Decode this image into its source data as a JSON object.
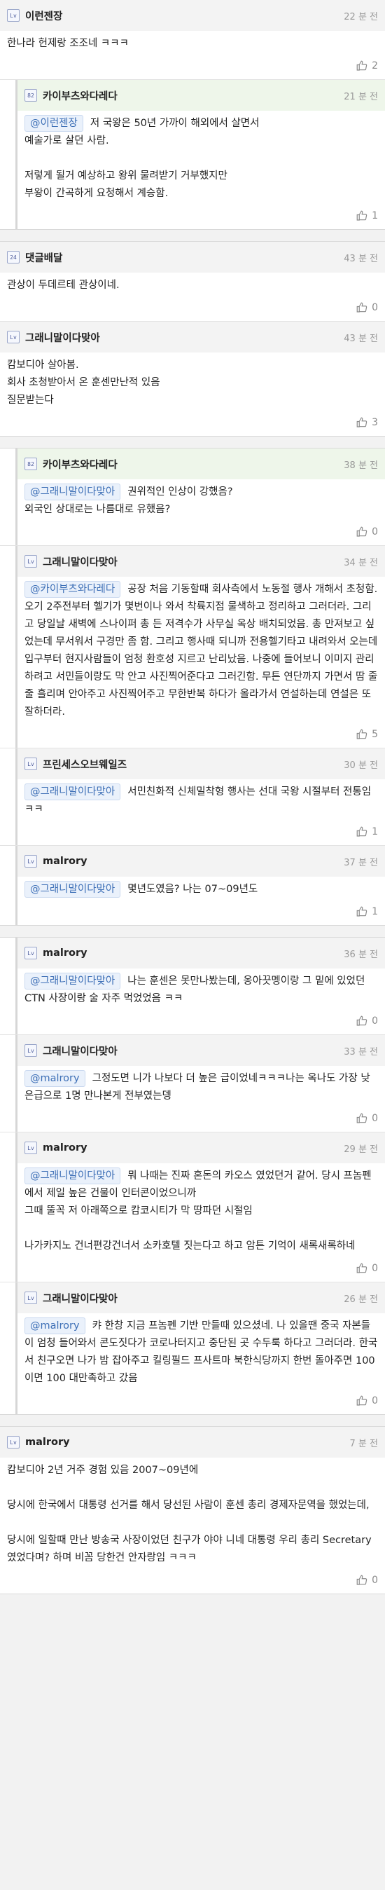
{
  "threads": [
    {
      "comments": [
        {
          "nick": "이런젠장",
          "time": "22 분 전",
          "level": "Lv",
          "header_bg": true,
          "mention": "",
          "text": "한나라 헌제랑 조조네 ㅋㅋㅋ",
          "likes": "2",
          "depth": 0
        },
        {
          "nick": "카이부츠와다레다",
          "time": "21 분 전",
          "level": "82",
          "header_bg": true,
          "hl": true,
          "mention": "@이런젠장",
          "text": "저 국왕은 50년 가까이 해외에서 살면서\n예술가로 살던 사람.\n\n저렇게 될거 예상하고 왕위 물려받기 거부했지만\n부왕이 간곡하게 요청해서 계승함.",
          "likes": "1",
          "depth": 1
        }
      ]
    },
    {
      "comments": [
        {
          "nick": "댓글배달",
          "time": "43 분 전",
          "level": "24",
          "header_bg": true,
          "mention": "",
          "text": "관상이 두데르테 관상이네.",
          "likes": "0",
          "depth": 0
        },
        {
          "nick": "그래니말이다맞아",
          "time": "43 분 전",
          "level": "Lv",
          "header_bg": true,
          "mention": "",
          "text": "캄보디아 살아봄.\n회사 초청받아서 온 훈센만난적 있음\n질문받는다",
          "likes": "3",
          "depth": 0
        }
      ]
    },
    {
      "comments": [
        {
          "nick": "카이부츠와다레다",
          "time": "38 분 전",
          "level": "82",
          "header_bg": true,
          "hl": true,
          "mention": "@그래니말이다맞아",
          "text": "권위적인 인상이 강했음?\n외국인 상대로는 나름대로 유했음?",
          "likes": "0",
          "depth": 1
        },
        {
          "nick": "그래니말이다맞아",
          "time": "34 분 전",
          "level": "Lv",
          "header_bg": true,
          "mention": "@카이부츠와다레다",
          "text": "공장 처음 기동할때 회사측에서 노동절 행사 개해서 초청함. 오기 2주전부터 헬기가 몇번이나 와서 착륙지점 물색하고 정리하고 그러더라. 그리고 당일날 새벽에 스나이퍼 총 든 저격수가 사무실 옥상 배치되었음. 총 만져보고 싶었는데 무서워서 구경만 좀 함. 그리고 행사때 되니까 전용헬기타고 내려와서 오는데 입구부터 현지사람들이 엄청 환호성 지르고 난리났음. 나중에 들어보니 이미지 관리하려고 서민들이랑도 막 안고 사진찍어준다고 그러긴함. 무튼 연단까지 가면서 땀 줄줄 흘리며 안아주고 사진찍어주고 무한반복 하다가 올라가서 연설하는데 연설은 또 잘하더라.",
          "likes": "5",
          "depth": 1
        },
        {
          "nick": "프린세스오브웨일즈",
          "time": "30 분 전",
          "level": "Lv",
          "header_bg": true,
          "mention": "@그래니말이다맞아",
          "text": "서민친화적 신체밀착형 행사는 선대 국왕 시절부터 전통임ㅋㅋ",
          "likes": "1",
          "depth": 1
        },
        {
          "nick": "malrory",
          "time": "37 분 전",
          "level": "Lv",
          "header_bg": true,
          "mention": "@그래니말이다맞아",
          "text": "몇년도였음? 나는 07~09년도",
          "likes": "1",
          "depth": 1
        }
      ]
    },
    {
      "comments": [
        {
          "nick": "malrory",
          "time": "36 분 전",
          "level": "Lv",
          "header_bg": true,
          "mention": "@그래니말이다맞아",
          "text": "나는 훈센은 못만나봤는데, 옹아끗멩이랑 그 밑에 있었던 CTN 사장이랑 술 자주 먹었었음 ㅋㅋ",
          "likes": "0",
          "depth": 1
        },
        {
          "nick": "그래니말이다맞아",
          "time": "33 분 전",
          "level": "Lv",
          "header_bg": true,
          "mention": "@malrory",
          "text": "그정도면 니가 나보다 더 높은 급이었네ㅋㅋㅋ나는 옥나도 가장 낮은급으로 1명 만나본게 전부였는뎅",
          "likes": "0",
          "depth": 1
        },
        {
          "nick": "malrory",
          "time": "29 분 전",
          "level": "Lv",
          "header_bg": true,
          "mention": "@그래니말이다맞아",
          "text": "뭐 나때는 진짜 혼돈의 카오스 였었던거 같어. 당시 프놈펜에서 제일 높은 건물이 인터콘이었으니까\n그때 뚤꼭 저 아래쪽으로 캄코시티가 막 땅파던 시절임\n\n나가카지노 건너편강건너서 소카호텔 짓는다고 하고 암튼 기억이 새록새록하네",
          "likes": "0",
          "depth": 1
        },
        {
          "nick": "그래니말이다맞아",
          "time": "26 분 전",
          "level": "Lv",
          "header_bg": true,
          "mention": "@malrory",
          "text": "캬 한창 지금 프놈펜 기반 만들때 있으셨네. 나 있을땐 중국 자본들이 엄청 들어와서 콘도짓다가 코로나터지고 중단된 곳 수두룩 하다고 그러더라. 한국서 친구오면 나가 밤 잡아주고 킬링필드 프사트마 북한식당까지 한번 돌아주면 100이면 100 대만족하고 갔음",
          "likes": "0",
          "depth": 1
        }
      ]
    },
    {
      "comments": [
        {
          "nick": "malrory",
          "time": "7 분 전",
          "level": "Lv",
          "header_bg": true,
          "mention": "",
          "text": "캄보디아 2년 거주 경험 있음 2007~09년에\n\n당시에 한국에서 대통령 선거를 해서 당선된 사람이 훈센 총리 경제자문역을 했었는데,\n\n당시에 일할때 만난 방송국 사장이었던 친구가 야야 니네 대통령 우리 총리 Secretary 였었다며? 하며 비꼼 당한건 안자랑임 ㅋㅋㅋ",
          "likes": "0",
          "depth": 0
        }
      ]
    }
  ],
  "icons": {
    "like": "thumbs-up-icon",
    "level": "level-badge-icon"
  }
}
